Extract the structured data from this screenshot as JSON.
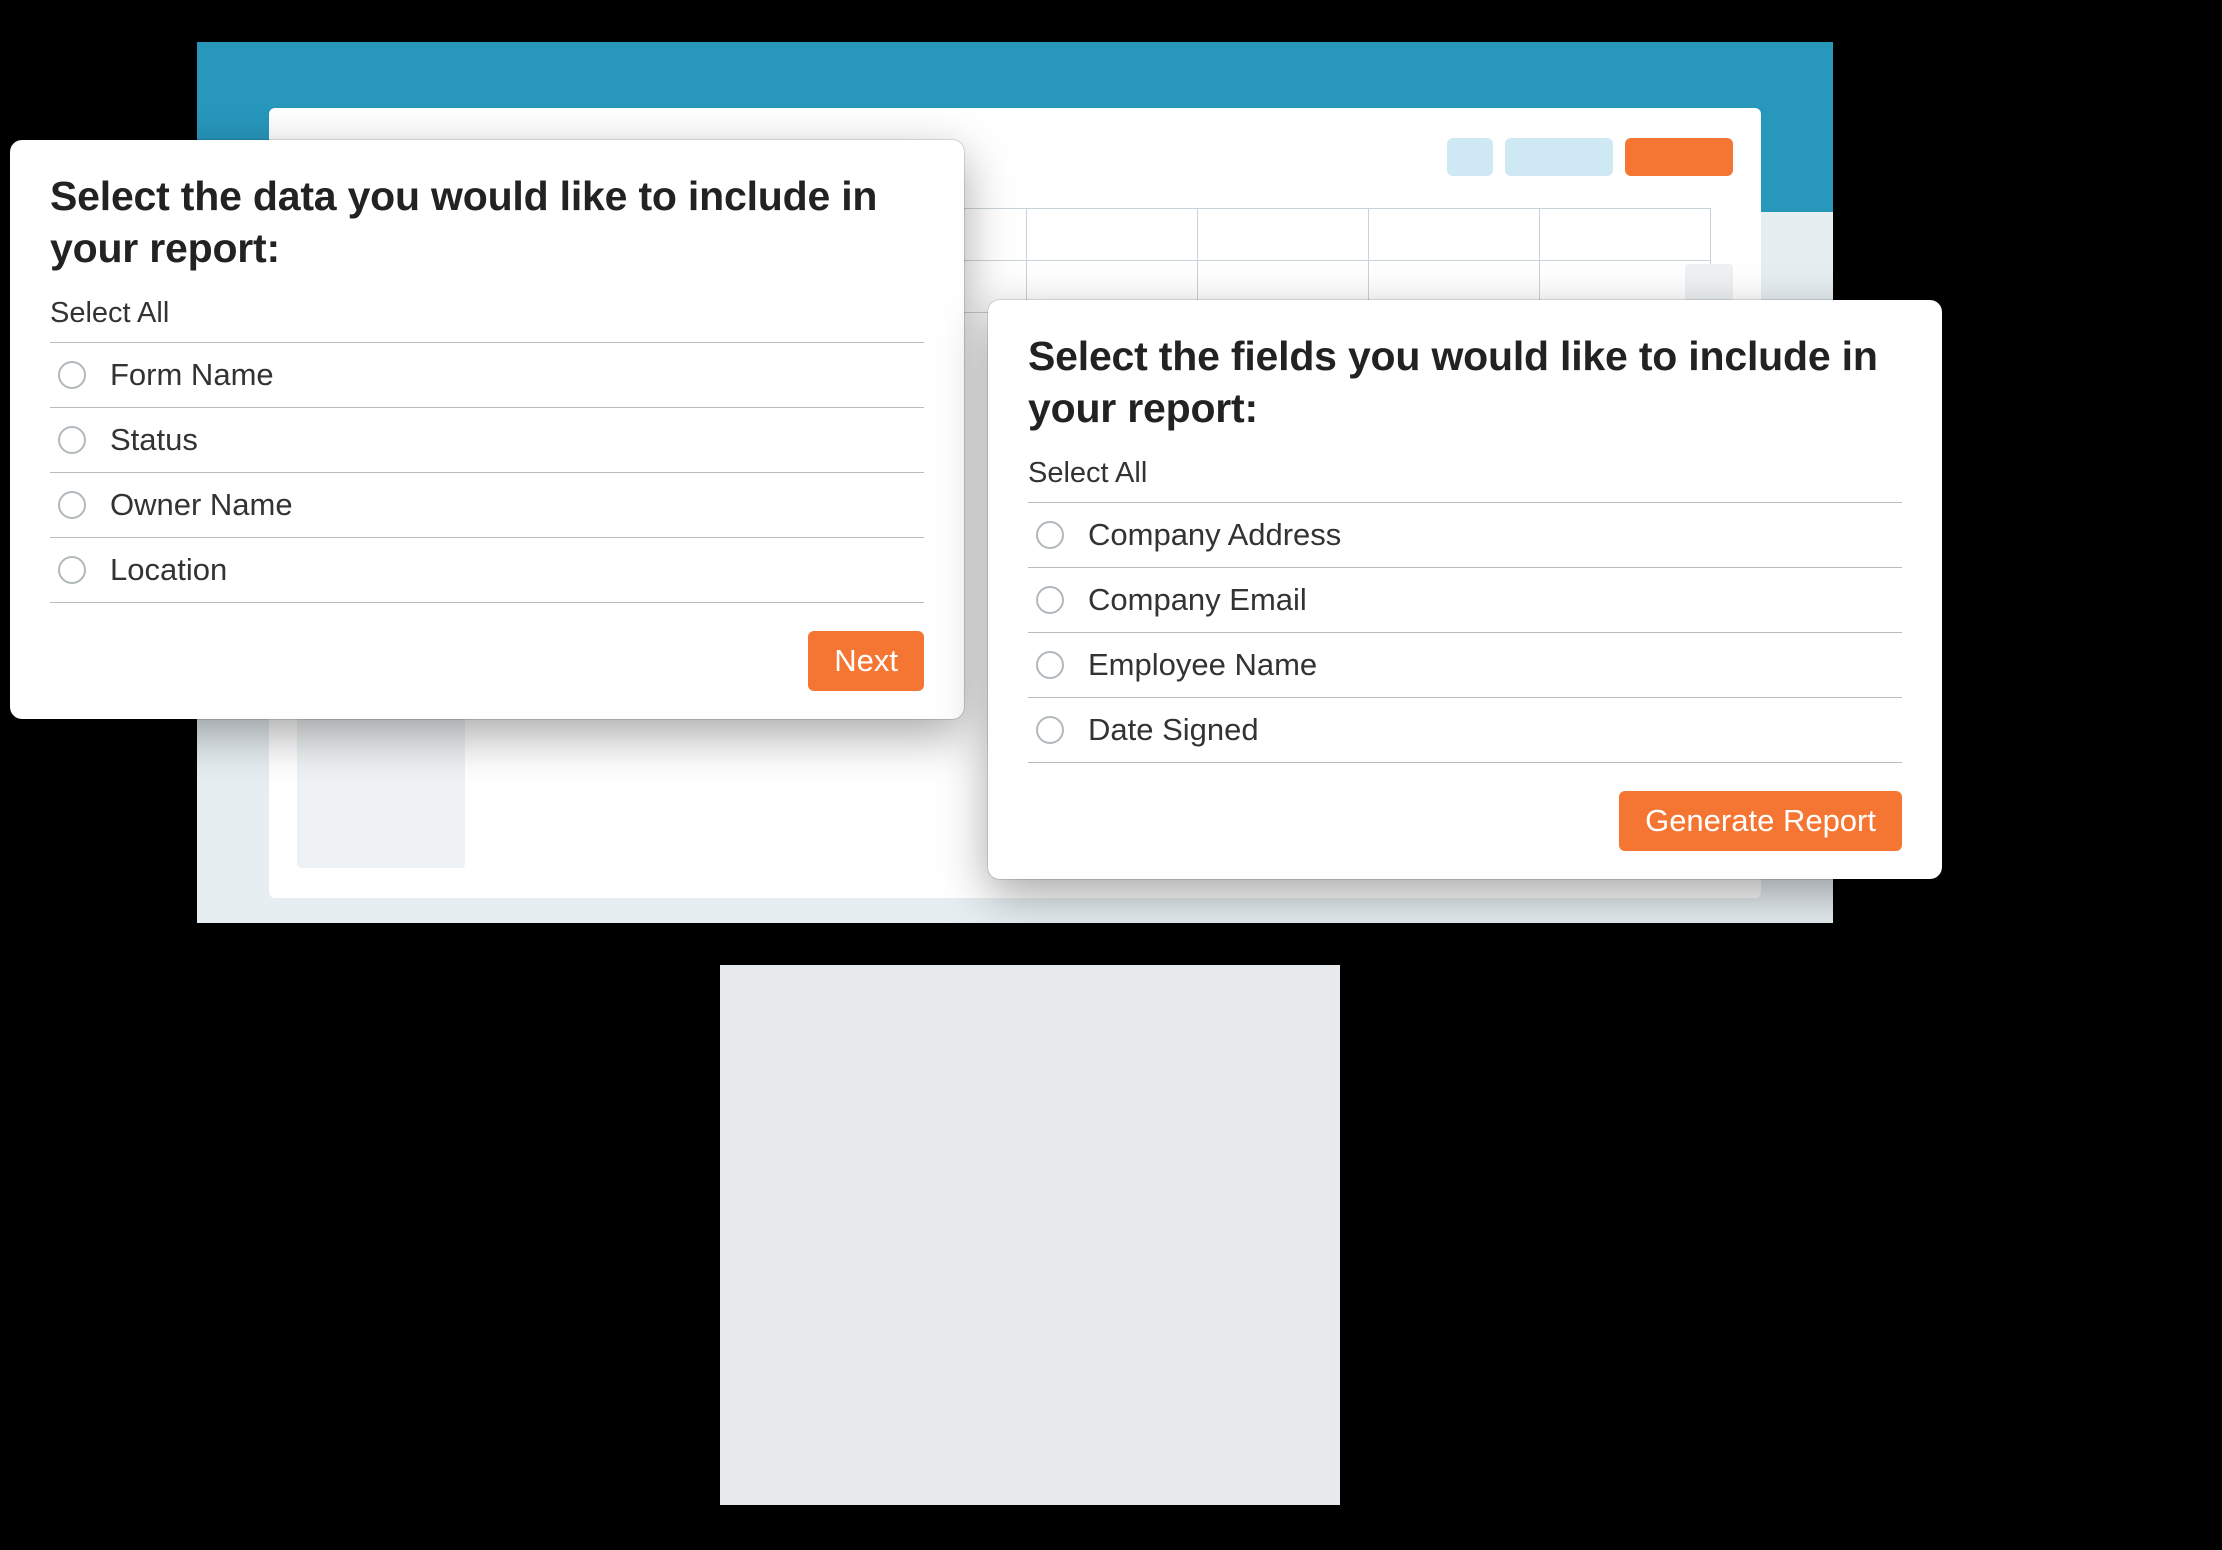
{
  "colors": {
    "accent": "#2797bc",
    "primary_action": "#f47632",
    "panel_bg": "#ffffff",
    "skeleton_bg": "#eef2f4",
    "border": "#b9bdbf"
  },
  "dialog_data": {
    "title": "Select the data you would like to include in your report:",
    "select_all_label": "Select All",
    "options": [
      {
        "label": "Form Name"
      },
      {
        "label": "Status"
      },
      {
        "label": "Owner Name"
      },
      {
        "label": "Location"
      }
    ],
    "action_label": "Next"
  },
  "dialog_fields": {
    "title": "Select the fields you would like to include in your report:",
    "select_all_label": "Select All",
    "options": [
      {
        "label": "Company Address"
      },
      {
        "label": "Company Email"
      },
      {
        "label": "Employee Name"
      },
      {
        "label": "Date Signed"
      }
    ],
    "action_label": "Generate Report"
  }
}
